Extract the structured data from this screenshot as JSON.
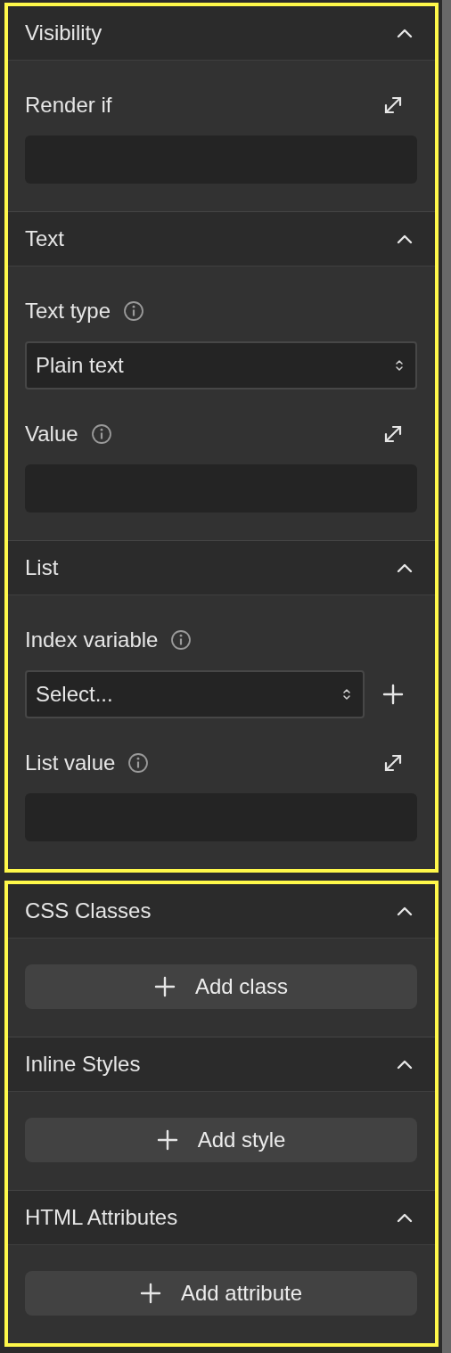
{
  "panels": [
    {
      "sections": [
        {
          "title": "Visibility",
          "expanded": true,
          "fields": [
            {
              "kind": "expression",
              "label": "Render if",
              "info": false
            }
          ]
        },
        {
          "title": "Text",
          "expanded": true,
          "fields": [
            {
              "kind": "select",
              "label": "Text type",
              "info": true,
              "value": "Plain text"
            },
            {
              "kind": "expression",
              "label": "Value",
              "info": true
            }
          ]
        },
        {
          "title": "List",
          "expanded": true,
          "fields": [
            {
              "kind": "select_add",
              "label": "Index variable",
              "info": true,
              "value": "Select..."
            },
            {
              "kind": "expression",
              "label": "List value",
              "info": true
            }
          ]
        }
      ]
    },
    {
      "sections": [
        {
          "title": "CSS Classes",
          "expanded": true,
          "button": "Add class"
        },
        {
          "title": "Inline Styles",
          "expanded": true,
          "button": "Add style"
        },
        {
          "title": "HTML Attributes",
          "expanded": true,
          "button": "Add attribute"
        }
      ]
    }
  ]
}
